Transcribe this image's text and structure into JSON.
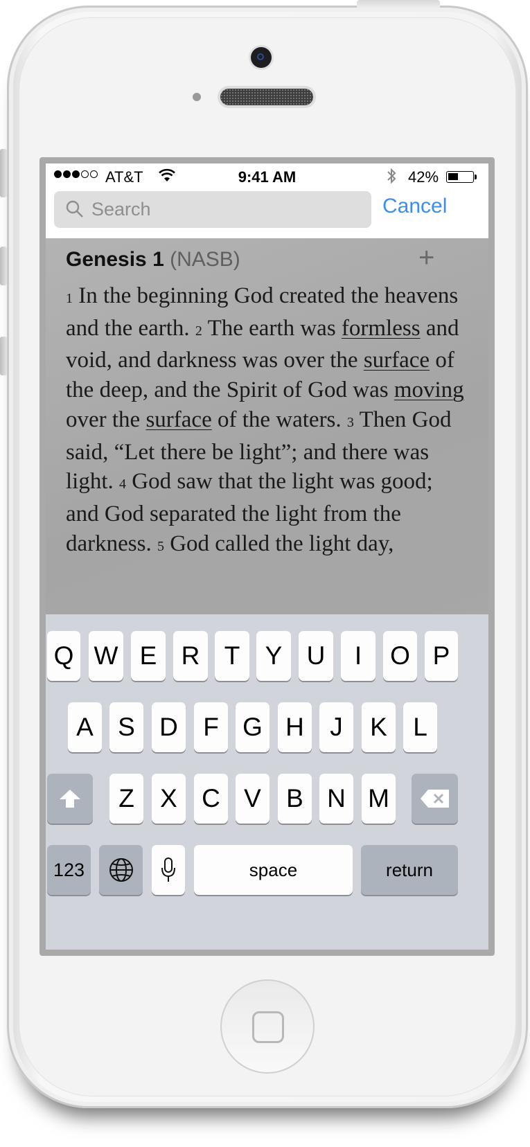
{
  "statusbar": {
    "carrier": "AT&T",
    "time": "9:41 AM",
    "battery": "42%",
    "signal_bars": 3,
    "signal_total": 5
  },
  "search": {
    "placeholder": "Search",
    "cancel_label": "Cancel"
  },
  "passage": {
    "book_chapter": "Genesis 1",
    "version": "(NASB)",
    "add_icon": "+",
    "verse_numbers": [
      "1",
      "2",
      "3",
      "4",
      "5"
    ],
    "segments": {
      "v1": "In the beginning God created the heavens and the earth.",
      "v2a": "The earth was",
      "v2_formless": "formless",
      "v2b": "and void, and darkness was over the",
      "v2_surface": "surface",
      "v2c": "of the deep, and the Spirit of God was",
      "v2_moving": "moving",
      "v2d": "over the",
      "v2_surface2": "surface",
      "v2e": "of the waters.",
      "v3": "Then God said, “Let there be light”; and there was light.",
      "v4": "God saw that the light was good; and God separated the light from the darkness.",
      "v5": "God called the light day,"
    }
  },
  "keyboard": {
    "row1": [
      "Q",
      "W",
      "E",
      "R",
      "T",
      "Y",
      "U",
      "I",
      "O",
      "P"
    ],
    "row2": [
      "A",
      "S",
      "D",
      "F",
      "G",
      "H",
      "J",
      "K",
      "L"
    ],
    "row3": [
      "Z",
      "X",
      "C",
      "V",
      "B",
      "N",
      "M"
    ],
    "numbers_label": "123",
    "space_label": "space",
    "return_label": "return"
  },
  "colors": {
    "accent": "#3b8ef0",
    "keyboard_bg": "#d1d5db",
    "dim_overlay": "#a6a6a6"
  }
}
